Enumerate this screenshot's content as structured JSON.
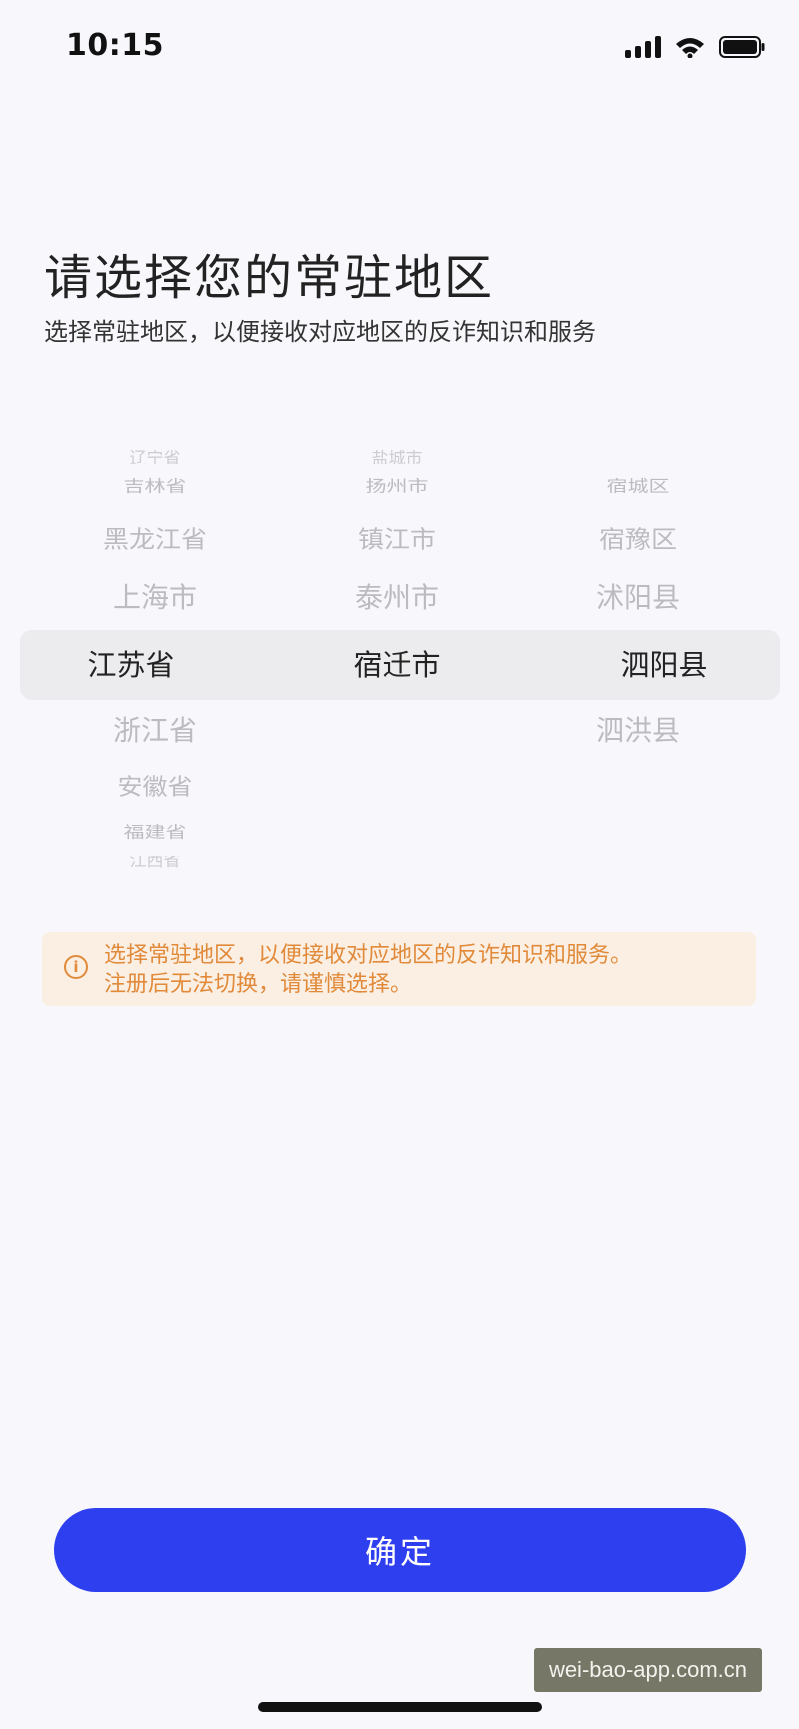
{
  "status_bar": {
    "time": "10:15",
    "icons": [
      "cellular-signal-icon",
      "wifi-icon",
      "battery-icon"
    ]
  },
  "page": {
    "title": "请选择您的常驻地区",
    "subtitle": "选择常驻地区，以便接收对应地区的反诈知识和服务"
  },
  "picker": {
    "provinces": [
      "辽宁省",
      "吉林省",
      "黑龙江省",
      "上海市",
      "江苏省",
      "浙江省",
      "安徽省",
      "福建省",
      "江西省"
    ],
    "selected_province": "江苏省",
    "cities": [
      "盐城市",
      "扬州市",
      "镇江市",
      "泰州市",
      "宿迁市"
    ],
    "selected_city": "宿迁市",
    "districts": [
      "宿城区",
      "宿豫区",
      "沭阳县",
      "泗阳县",
      "泗洪县"
    ],
    "selected_district": "泗阳县"
  },
  "notice": {
    "icon": "info-circle-icon",
    "line1": "选择常驻地区，以便接收对应地区的反诈知识和服务。",
    "line2": "注册后无法切换，请谨慎选择。",
    "color": "#e08a3a",
    "background": "#fbeee2"
  },
  "confirm_button": {
    "label": "确定",
    "color": "#2e3ff0"
  },
  "watermark": "wei-bao-app.com.cn"
}
